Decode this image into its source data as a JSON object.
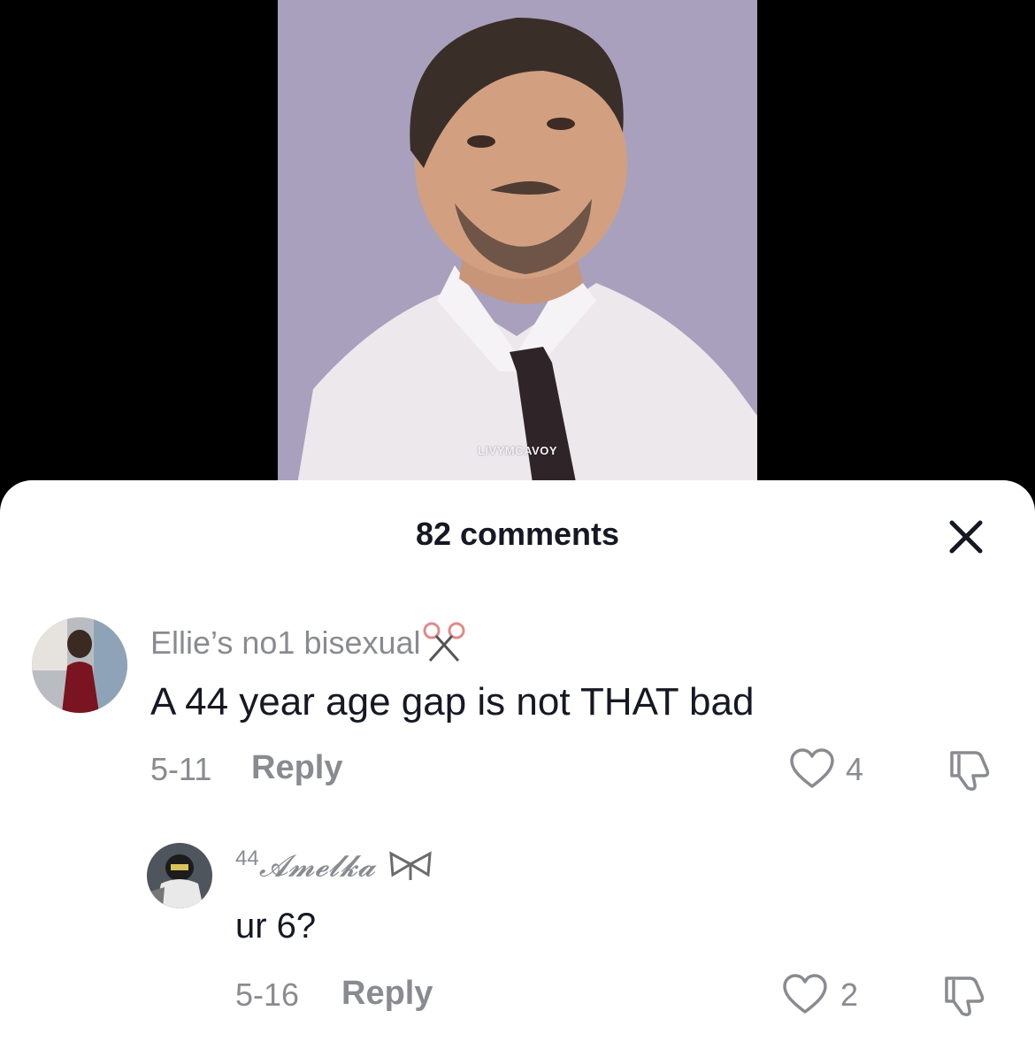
{
  "video": {
    "watermark": "LIVYMCAVOY"
  },
  "comments_panel": {
    "title": "82 comments",
    "close_icon": "close-icon"
  },
  "comments": [
    {
      "username": "Ellie’s no1 bisexual",
      "username_decoration_icon": "scissors-icon",
      "text": "A 44 year age gap is not THAT bad",
      "date": "5-11",
      "reply_label": "Reply",
      "likes": "4"
    },
    {
      "username_prefix": "44",
      "username": "𝓐𝓶𝓮𝓵𝓴𝓪",
      "username_decoration_icon": "bow-icon",
      "text": "ur 6?",
      "date": "5-16",
      "reply_label": "Reply",
      "likes": "2"
    }
  ],
  "colors": {
    "sheet_bg": "#ffffff",
    "muted": "#8a8b91",
    "text": "#161823",
    "video_bg": "#a9a0bd"
  }
}
